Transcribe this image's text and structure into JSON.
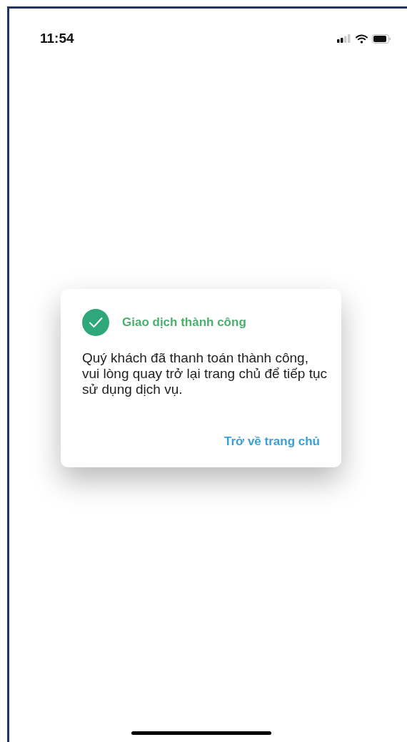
{
  "status_bar": {
    "time": "11:54"
  },
  "dialog": {
    "title": "Giao dịch thành công",
    "message": "Quý khách đã thanh toán thành công, vui lòng quay trở lại trang chủ để tiếp tục sử dụng dịch vụ.",
    "action": "Trở về trang chủ"
  }
}
